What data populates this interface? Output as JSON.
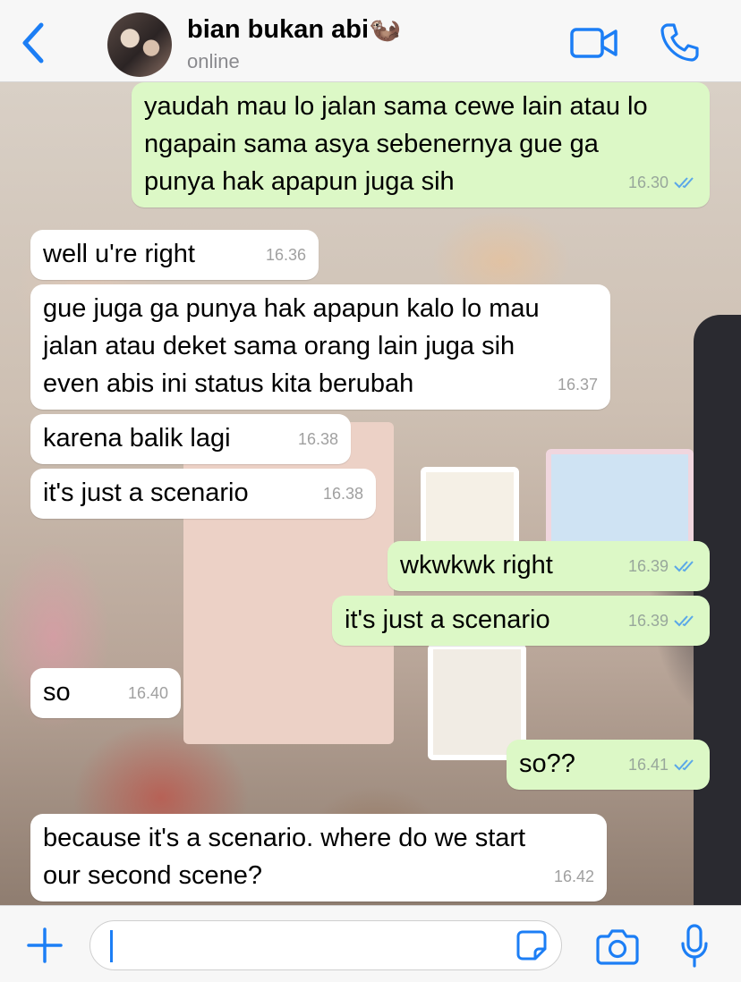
{
  "colors": {
    "accent": "#1c7ef5",
    "incoming_bubble": "#ffffff",
    "outgoing_bubble": "#dcf8c6",
    "read_ticks": "#5aa7e8"
  },
  "header": {
    "back_icon": "chevron-left-icon",
    "contact_name": "bian bukan abi🦦",
    "status": "online",
    "video_icon": "video-camera-icon",
    "call_icon": "phone-icon"
  },
  "messages": [
    {
      "direction": "out",
      "text": "yaudah mau lo jalan sama cewe lain atau lo\nngapain sama asya sebenernya gue ga\npunya hak apapun juga sih",
      "time": "16.30",
      "read": true
    },
    {
      "direction": "in",
      "text": "well u're right",
      "time": "16.36"
    },
    {
      "direction": "in",
      "text": "gue juga ga punya hak apapun kalo lo mau\njalan atau deket sama orang lain juga sih\neven abis ini status kita berubah",
      "time": "16.37"
    },
    {
      "direction": "in",
      "text": "karena balik lagi",
      "time": "16.38"
    },
    {
      "direction": "in",
      "text": "it's just a scenario",
      "time": "16.38"
    },
    {
      "direction": "out",
      "text": "wkwkwk right",
      "time": "16.39",
      "read": true
    },
    {
      "direction": "out",
      "text": "it's just a scenario",
      "time": "16.39",
      "read": true
    },
    {
      "direction": "in",
      "text": "so",
      "time": "16.40"
    },
    {
      "direction": "out",
      "text": "so??",
      "time": "16.41",
      "read": true
    },
    {
      "direction": "in",
      "text": "because it's a scenario. where do we start\nour second scene?",
      "time": "16.42"
    }
  ],
  "input_bar": {
    "plus_icon": "plus-icon",
    "message_value": "",
    "sticker_icon": "sticker-icon",
    "camera_icon": "camera-icon",
    "mic_icon": "microphone-icon"
  }
}
